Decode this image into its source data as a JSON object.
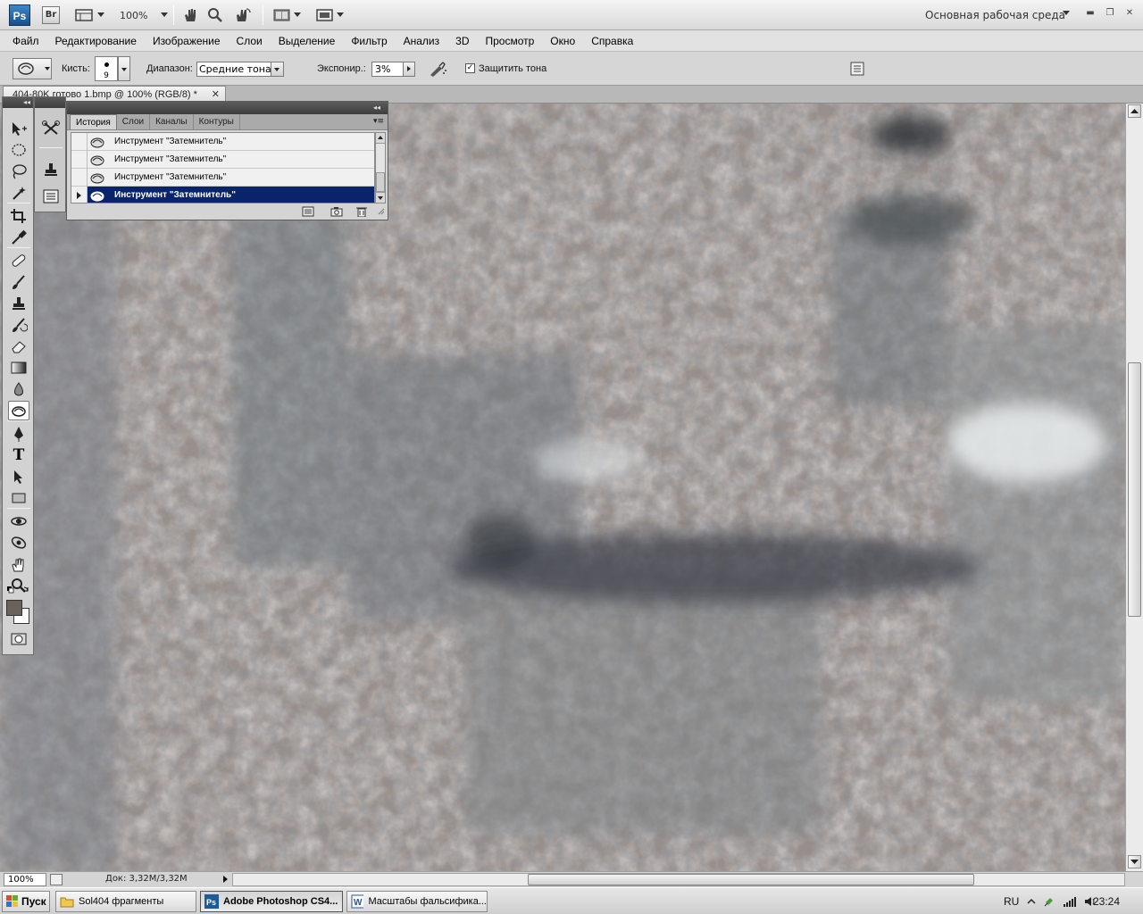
{
  "app": {
    "logo": "Ps",
    "bridge": "Br",
    "zoom": "100%",
    "workspace": "Основная рабочая среда",
    "window_min": "▬",
    "window_restore": "❐",
    "window_close": "✕"
  },
  "menu": [
    "Файл",
    "Редактирование",
    "Изображение",
    "Слои",
    "Выделение",
    "Фильтр",
    "Анализ",
    "3D",
    "Просмотр",
    "Окно",
    "Справка"
  ],
  "options": {
    "brush_label": "Кисть:",
    "brush_size": "9",
    "range_label": "Диапазон:",
    "range_value": "Средние тона",
    "exposure_label": "Экспонир.:",
    "exposure_value": "3%",
    "protect_label": "Защитить тона",
    "protect_checked": "✓"
  },
  "document": {
    "tab_title": "404-80K готово 1.bmp @ 100% (RGB/8) *",
    "close": "✕"
  },
  "history_panel": {
    "tabs": [
      "История",
      "Слои",
      "Каналы",
      "Контуры"
    ],
    "menu_icon": "▾≡",
    "collapse": "◂◂",
    "items": [
      {
        "label": "Инструмент \"Затемнитель\"",
        "active": false
      },
      {
        "label": "Инструмент \"Затемнитель\"",
        "active": false
      },
      {
        "label": "Инструмент \"Затемнитель\"",
        "active": false
      },
      {
        "label": "Инструмент \"Затемнитель\"",
        "active": true
      }
    ]
  },
  "toolbox": {
    "collapse": "◂◂",
    "tools": [
      "move-tool",
      "marquee-tool",
      "lasso-tool",
      "quick-select-tool",
      "crop-tool",
      "eyedropper-tool",
      "healing-tool",
      "brush-tool",
      "clone-stamp-tool",
      "history-brush-tool",
      "eraser-tool",
      "gradient-tool",
      "blur-tool",
      "dodge-burn-tool",
      "pen-tool",
      "type-tool",
      "path-select-tool",
      "shape-tool",
      "3d-rotate-tool",
      "3d-orbit-tool",
      "hand-tool",
      "zoom-tool"
    ],
    "active_tool": "dodge-burn-tool",
    "type_glyph": "T",
    "foreground_color": "#6b625c",
    "background_color": "#ffffff"
  },
  "status": {
    "zoom": "100%",
    "doc_info": "Док: 3,32M/3,32M"
  },
  "taskbar": {
    "start": "Пуск",
    "tasks": [
      {
        "label": "Sol404 фрагменты",
        "active": false
      },
      {
        "label": "Adobe Photoshop CS4...",
        "active": true
      },
      {
        "label": "Масштабы фальсифика...",
        "active": false
      }
    ],
    "lang": "RU",
    "time": "23:24"
  }
}
